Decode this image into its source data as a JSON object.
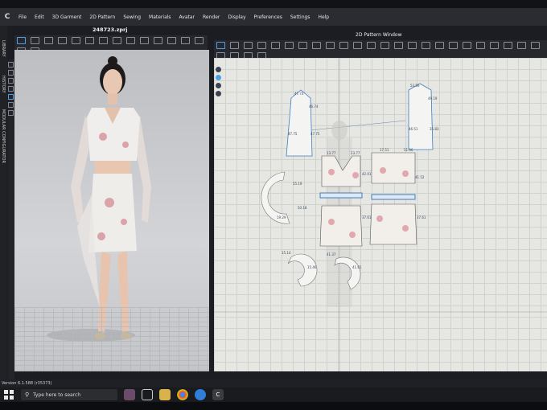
{
  "app": {
    "logo_glyph": "C",
    "filename": "248723.zprj",
    "version": "Version 6.1.588 (r35373)"
  },
  "menus": [
    "File",
    "Edit",
    "3D Garment",
    "2D Pattern",
    "Sewing",
    "Materials",
    "Avatar",
    "Render",
    "Display",
    "Preferences",
    "Settings",
    "Help"
  ],
  "side_labels": [
    "LIBRARY",
    "HISTORY",
    "MODULAR CONFIGURATOR"
  ],
  "pattern_window": {
    "title": "2D Pattern Window"
  },
  "pattern_measurements": [
    "47.73",
    "46.74",
    "47.75",
    "47.75",
    "53.56",
    "49.19",
    "46.51",
    "35.83",
    "13.77",
    "13.77",
    "17.51",
    "51.96",
    "42.01",
    "41.52",
    "37.61",
    "37.61",
    "55.19",
    "50.18",
    "19.29",
    "15.14",
    "15.46",
    "41.37",
    "41.81"
  ],
  "taskbar": {
    "search_placeholder": "Type here to search"
  },
  "colors": {
    "accent": "#4aa3e0",
    "pattern_bg": "#e6e7e2",
    "panel": "#26282d"
  }
}
